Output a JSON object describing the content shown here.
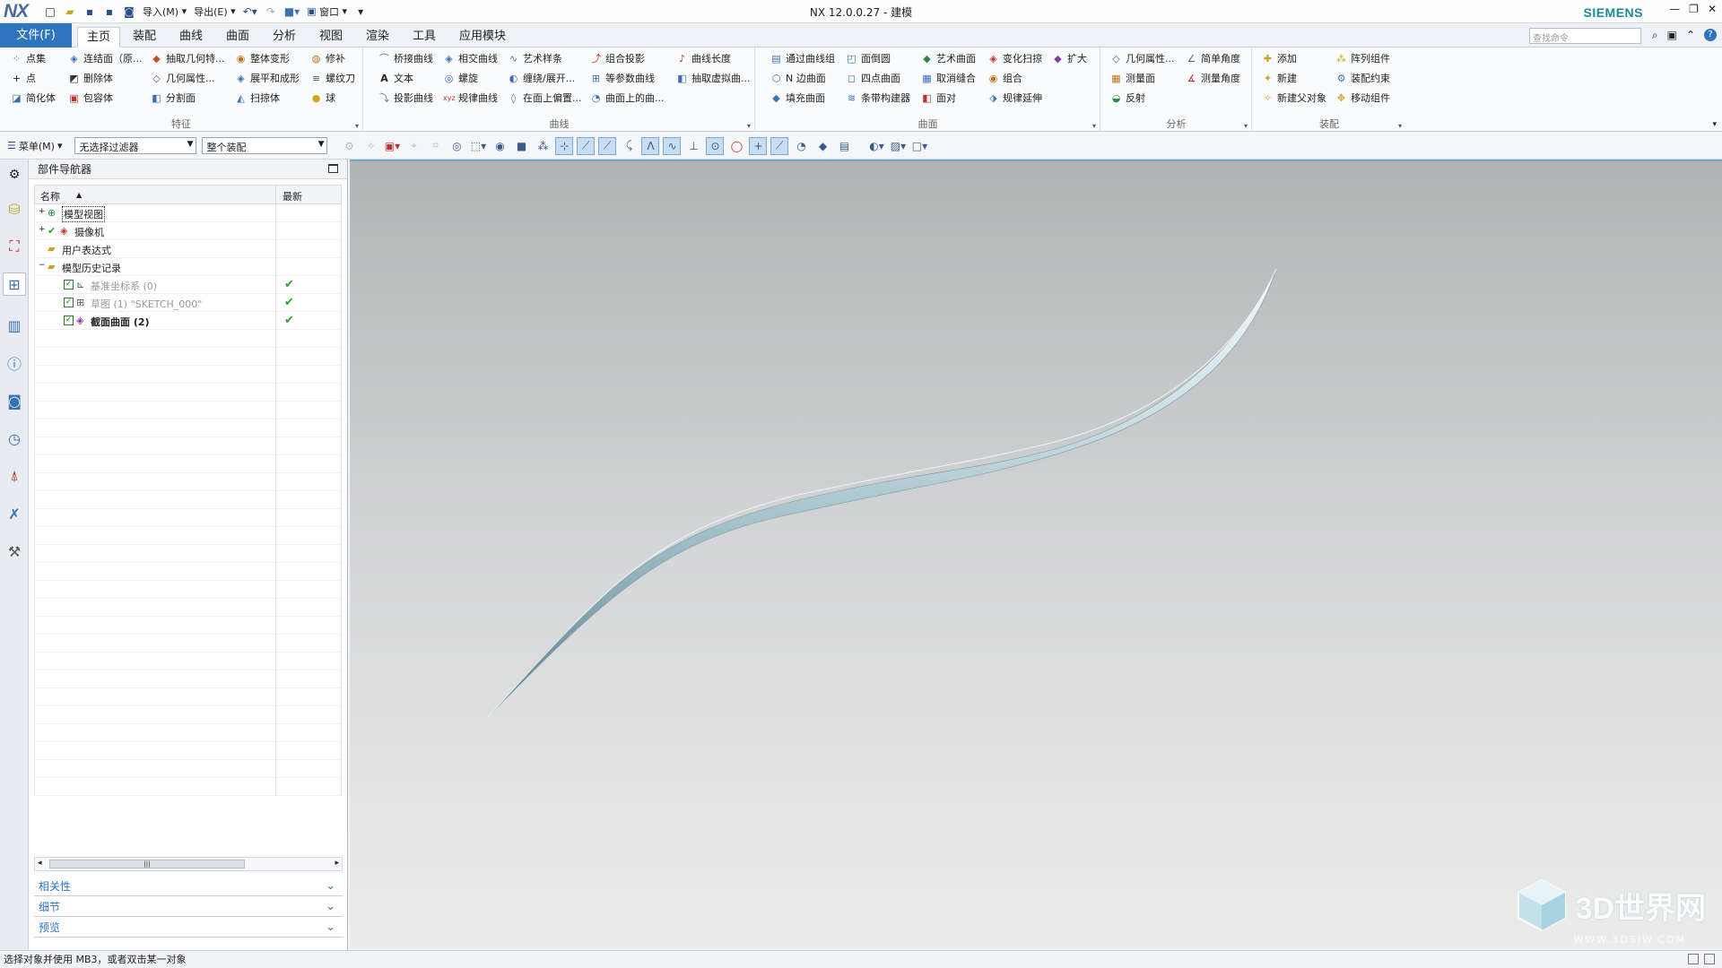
{
  "titlebar": {
    "logo": "NX",
    "import_label": "导入(M)",
    "export_label": "导出(E)",
    "window_label": "窗口",
    "title": "NX 12.0.0.27 - 建模",
    "brand": "SIEMENS"
  },
  "tabs": {
    "file": "文件(F)",
    "items": [
      "主页",
      "装配",
      "曲线",
      "曲面",
      "分析",
      "视图",
      "渲染",
      "工具",
      "应用模块"
    ],
    "active": "主页",
    "search_placeholder": "查找命令"
  },
  "ribbon": {
    "features": {
      "label": "特征",
      "items": [
        "点集",
        "连结面（原...",
        "抽取几何特...",
        "整体变形",
        "修补",
        "点",
        "删除体",
        "几何属性...",
        "展平和成形",
        "螺纹刀",
        "简化体",
        "包容体",
        "分割面",
        "扫掠体",
        "球"
      ]
    },
    "curve": {
      "label": "曲线",
      "items": [
        "桥接曲线",
        "相交曲线",
        "艺术样条",
        "组合投影",
        "曲线长度",
        "文本",
        "螺旋",
        "缠绕/展开...",
        "等参数曲线",
        "抽取虚拟曲...",
        "投影曲线",
        "规律曲线",
        "在面上偏置...",
        "曲面上的曲..."
      ]
    },
    "surface": {
      "label": "曲面",
      "items": [
        "通过曲线组",
        "面倒圆",
        "艺术曲面",
        "变化扫掠",
        "扩大",
        "N 边曲面",
        "四点曲面",
        "取消缝合",
        "组合",
        "填充曲面",
        "条带构建器",
        "面对",
        "规律延伸"
      ]
    },
    "analysis": {
      "label": "分析",
      "items": [
        "几何属性...",
        "简单角度",
        "测量面",
        "测量角度",
        "反射"
      ]
    },
    "assembly": {
      "label": "装配",
      "items": [
        "添加",
        "阵列组件",
        "新建",
        "装配约束",
        "新建父对象",
        "移动组件"
      ]
    }
  },
  "toolbar2": {
    "menu": "菜单(M)",
    "filter": "无选择过滤器",
    "scope": "整个装配"
  },
  "navigator": {
    "title": "部件导航器",
    "col_name": "名称",
    "col_latest": "最新",
    "rows": [
      {
        "label": "模型视图"
      },
      {
        "label": "摄像机"
      },
      {
        "label": "用户表达式"
      },
      {
        "label": "模型历史记录"
      },
      {
        "label": "基准坐标系 (0)"
      },
      {
        "label": "草图 (1) \"SKETCH_000\""
      },
      {
        "label": "截面曲面 (2)"
      }
    ],
    "panels": [
      "相关性",
      "细节",
      "预览"
    ]
  },
  "status": {
    "text": "选择对象并使用 MB3，或者双击某一对象"
  },
  "watermark": {
    "text": "3D世界网",
    "sub": "WWW.3DSJW.COM"
  }
}
